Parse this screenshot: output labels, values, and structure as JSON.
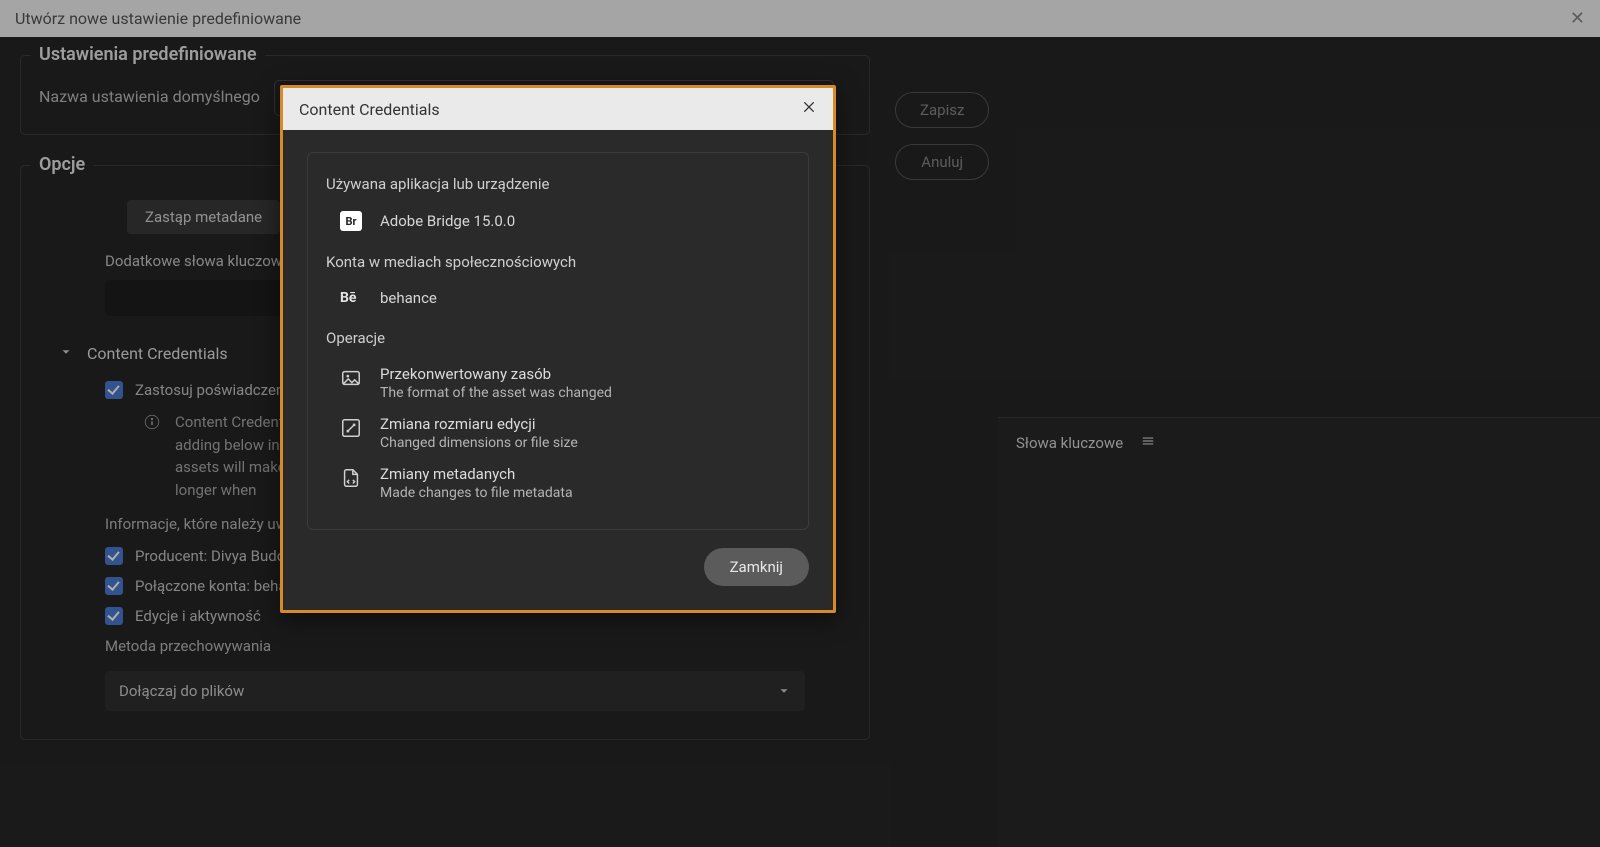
{
  "bg": {
    "title": "Utwórz nowe ustawienie predefiniowane",
    "preset": {
      "group_title": "Ustawienia predefiniowane",
      "name_label": "Nazwa ustawienia domyślnego"
    },
    "options": {
      "group_title": "Opcje",
      "replace_btn": "Zastąp metadane",
      "keywords_label": "Dodatkowe słowa kluczowe",
      "cc_section_title": "Content Credentials",
      "apply_label": "Zastosuj poświadczenia",
      "info_text": "Content Credentials adding below info assets will make take longer when",
      "include_label": "Informacje, które należy uw",
      "producer_label": "Producent: Divya Budd",
      "accounts_label": "Połączone konta: behar",
      "edits_label": "Edycje i aktywność",
      "storage_label": "Metoda przechowywania",
      "storage_value": "Dołączaj do plików"
    },
    "actions": {
      "save": "Zapisz",
      "cancel": "Anuluj"
    }
  },
  "cc_dialog": {
    "title": "Content Credentials",
    "app_heading": "Używana aplikacja lub urządzenie",
    "app_name": "Adobe Bridge 15.0.0",
    "social_heading": "Konta w mediach społecznościowych",
    "social_name": "behance",
    "ops_heading": "Operacje",
    "ops": [
      {
        "title": "Przekonwertowany zasób",
        "desc": "The format of the asset was changed",
        "icon": "image"
      },
      {
        "title": "Zmiana rozmiaru edycji",
        "desc": "Changed dimensions or file size",
        "icon": "resize"
      },
      {
        "title": "Zmiany metadanych",
        "desc": "Made changes to file metadata",
        "icon": "metadata"
      }
    ],
    "close_btn": "Zamknij"
  },
  "keywords_panel": {
    "title": "Słowa kluczowe"
  }
}
